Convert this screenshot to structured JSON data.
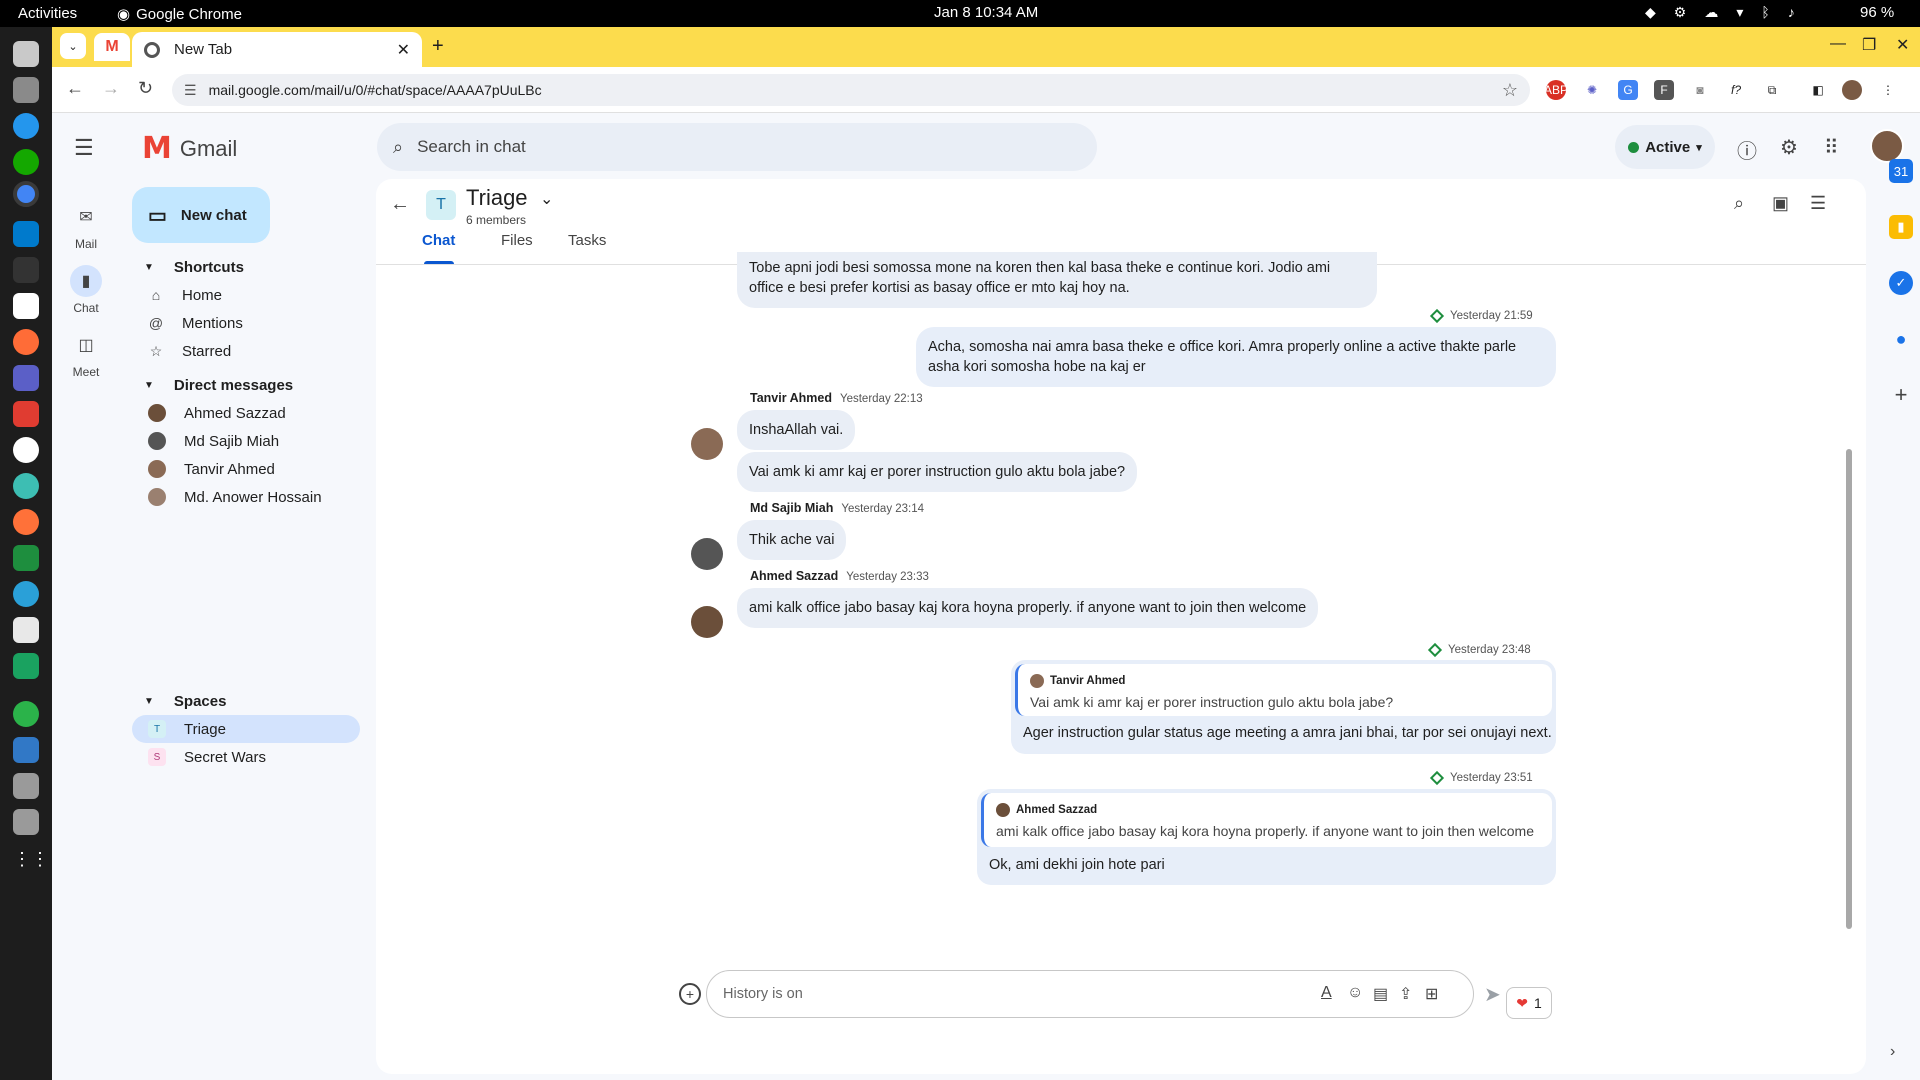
{
  "system_bar": {
    "activities": "Activities",
    "app_name": "Google Chrome",
    "clock": "Jan 8  10:34 AM",
    "battery": "96 %"
  },
  "browser": {
    "tab_title": "New Tab",
    "url": "mail.google.com/mail/u/0/#chat/space/AAAA7pUuLBc"
  },
  "gmail": {
    "app_name": "Gmail",
    "search_placeholder": "Search in chat",
    "status": "Active",
    "rail": {
      "mail": "Mail",
      "chat": "Chat",
      "meet": "Meet"
    },
    "new_chat": "New chat",
    "shortcuts": {
      "title": "Shortcuts",
      "items": [
        "Home",
        "Mentions",
        "Starred"
      ]
    },
    "direct_messages": {
      "title": "Direct messages",
      "items": [
        "Ahmed Sazzad",
        "Md Sajib Miah",
        "Tanvir Ahmed",
        "Md. Anower Hossain"
      ]
    },
    "spaces": {
      "title": "Spaces",
      "items": [
        {
          "letter": "T",
          "name": "Triage"
        },
        {
          "letter": "S",
          "name": "Secret Wars"
        }
      ]
    }
  },
  "space": {
    "avatar_letter": "T",
    "name": "Triage",
    "members": "6 members",
    "tabs": [
      "Chat",
      "Files",
      "Tasks"
    ],
    "active_tab": "Chat"
  },
  "messages": {
    "m0_text": "Tobe apni jodi besi somossa mone na koren then kal basa theke e continue kori. Jodio ami office e besi prefer kortisi as basay office er mto kaj hoy na.",
    "m1_time": "Yesterday 21:59",
    "m1_text": "Acha, somosha nai amra basa theke e office kori. Amra properly online a active thakte parle asha kori somosha hobe na kaj er",
    "m2_sender": "Tanvir Ahmed",
    "m2_time": "Yesterday 22:13",
    "m2_text_a": "InshaAllah vai.",
    "m2_text_b": "Vai amk ki amr kaj er porer instruction gulo aktu bola jabe?",
    "m3_sender": "Md Sajib Miah",
    "m3_time": "Yesterday 23:14",
    "m3_text": "Thik ache vai",
    "m4_sender": "Ahmed Sazzad",
    "m4_time": "Yesterday 23:33",
    "m4_text": "ami kalk office jabo basay kaj kora hoyna properly. if anyone want to join then welcome",
    "m5_time": "Yesterday 23:48",
    "m5_quote_name": "Tanvir Ahmed",
    "m5_quote_text": "Vai amk ki amr kaj er porer instruction gulo aktu bola jabe?",
    "m5_reply": "Ager instruction gular status age meeting a amra jani bhai, tar por sei onujayi next.",
    "m6_time": "Yesterday 23:51",
    "m6_quote_name": "Ahmed Sazzad",
    "m6_quote_text": "ami kalk office jabo basay kaj kora hoyna properly. if anyone want to join then welcome",
    "m6_reply": "Ok, ami dekhi join hote pari",
    "reaction_count": "1"
  },
  "composer": {
    "placeholder": "History is on"
  },
  "colors": {
    "chrome_tabstrip": "#fcdc4d",
    "accent_blue": "#0b57d0",
    "active_green": "#1e8e3e",
    "selected_bg": "#d3e3fd"
  }
}
